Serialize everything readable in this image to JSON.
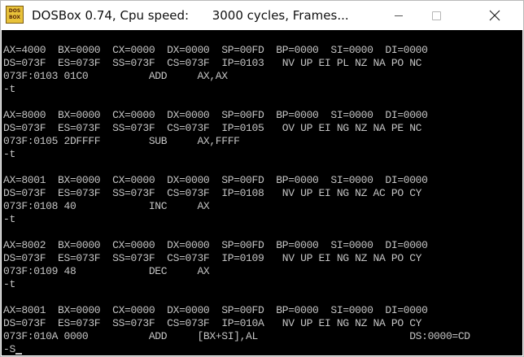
{
  "window": {
    "title": "DOSBox 0.74, Cpu speed:      3000 cycles, Frames...",
    "icon_name": "dosbox-icon",
    "icon_text_line1": "DOS",
    "icon_text_line2": "BOX",
    "minimize_icon": "minimize-icon",
    "maximize_icon": "maximize-icon",
    "close_icon": "close-icon"
  },
  "console": {
    "lines": [
      "AX=4000  BX=0000  CX=0000  DX=0000  SP=00FD  BP=0000  SI=0000  DI=0000",
      "DS=073F  ES=073F  SS=073F  CS=073F  IP=0103   NV UP EI PL NZ NA PO NC",
      "073F:0103 01C0          ADD     AX,AX",
      "-t",
      "",
      "AX=8000  BX=0000  CX=0000  DX=0000  SP=00FD  BP=0000  SI=0000  DI=0000",
      "DS=073F  ES=073F  SS=073F  CS=073F  IP=0105   OV UP EI NG NZ NA PE NC",
      "073F:0105 2DFFFF        SUB     AX,FFFF",
      "-t",
      "",
      "AX=8001  BX=0000  CX=0000  DX=0000  SP=00FD  BP=0000  SI=0000  DI=0000",
      "DS=073F  ES=073F  SS=073F  CS=073F  IP=0108   NV UP EI NG NZ AC PO CY",
      "073F:0108 40            INC     AX",
      "-t",
      "",
      "AX=8002  BX=0000  CX=0000  DX=0000  SP=00FD  BP=0000  SI=0000  DI=0000",
      "DS=073F  ES=073F  SS=073F  CS=073F  IP=0109   NV UP EI NG NZ NA PO CY",
      "073F:0109 48            DEC     AX",
      "-t",
      "",
      "AX=8001  BX=0000  CX=0000  DX=0000  SP=00FD  BP=0000  SI=0000  DI=0000",
      "DS=073F  ES=073F  SS=073F  CS=073F  IP=010A   NV UP EI NG NZ NA PO CY",
      "073F:010A 0000          ADD     [BX+SI],AL                         DS:0000=CD",
      "-S"
    ],
    "text_color": "#c4c4c4",
    "background_color": "#000000"
  }
}
